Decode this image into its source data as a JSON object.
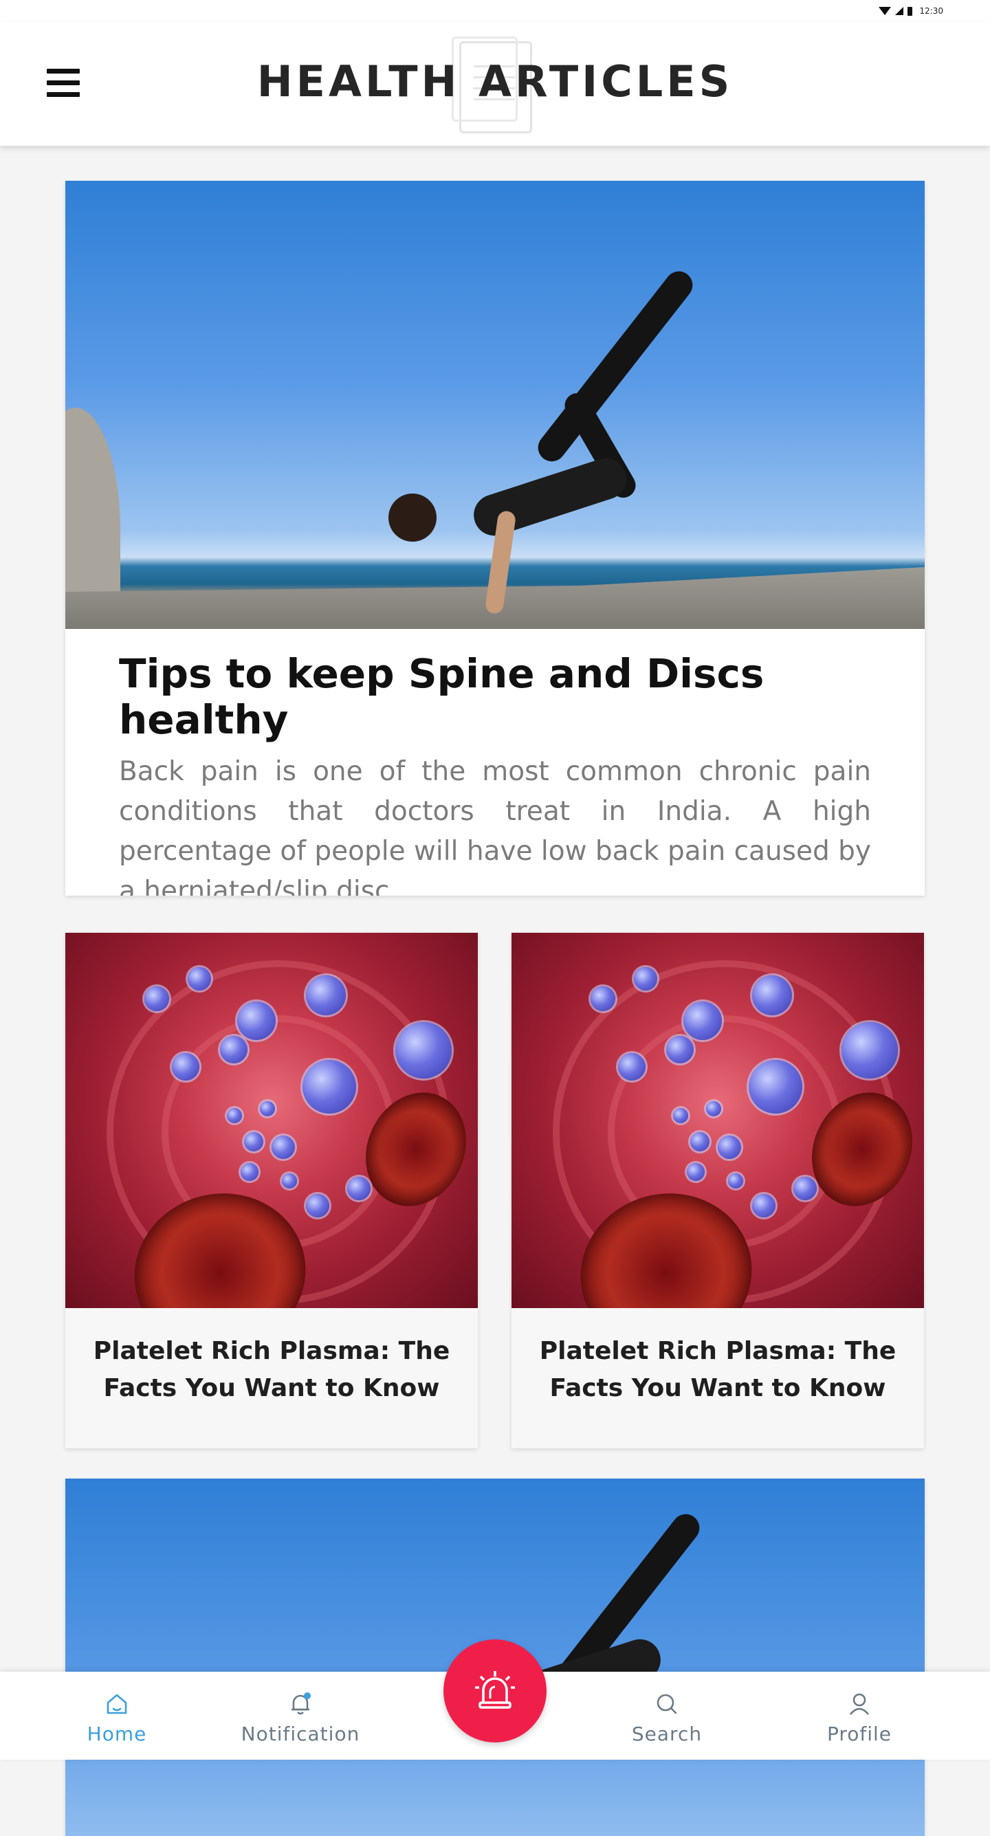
{
  "status_bar": {
    "time": "12:30"
  },
  "header": {
    "title": "HEALTH ARTICLES",
    "menu_icon": "hamburger-menu-icon"
  },
  "articles": {
    "featured": {
      "title": "Tips to keep Spine and Discs healthy",
      "summary": "Back pain is one of the most common chronic pain conditions that doctors treat in India. A high percentage of people will have low back pain caused by a herniated/slip disc."
    },
    "grid": [
      {
        "title": "Platelet Rich Plasma: The Facts You Want to Know"
      },
      {
        "title": "Platelet Rich Plasma: The Facts You Want to Know"
      }
    ]
  },
  "bottom_nav": {
    "items": [
      {
        "label": "Home",
        "icon": "home-icon",
        "active": true
      },
      {
        "label": "Notification",
        "icon": "bell-icon"
      },
      {
        "label": "Search",
        "icon": "search-icon"
      },
      {
        "label": "Profile",
        "icon": "user-icon"
      }
    ],
    "fab_icon": "alarm-siren-icon"
  },
  "colors": {
    "accent": "#3aa0dc",
    "fab": "#ef1f4a",
    "nav_inactive": "#6a7a86",
    "summary_text": "#7b7b7b"
  }
}
